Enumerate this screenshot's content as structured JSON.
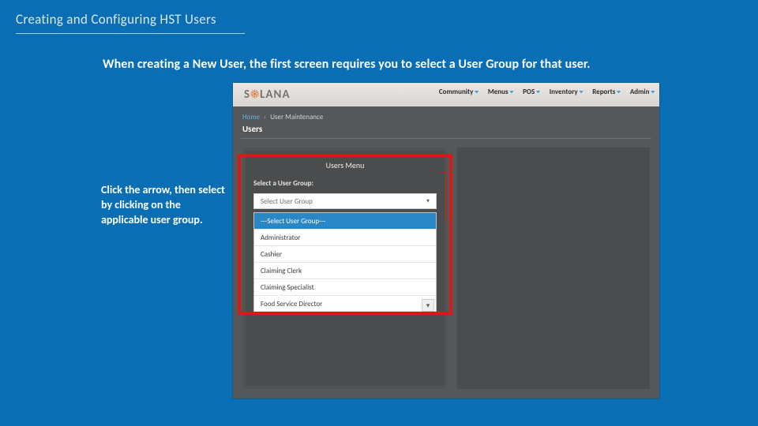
{
  "slide": {
    "title": "Creating  and Configuring HST Users",
    "intro": "When creating a New User, the first screen requires you to select a User Group for that user.",
    "tip": "Click the arrow, then select by clicking on the applicable user group."
  },
  "app": {
    "logo_left": "S",
    "logo_sun": "☀",
    "logo_right": "LANA",
    "nav": [
      "Community",
      "Menus",
      "POS",
      "Inventory",
      "Reports",
      "Admin"
    ],
    "breadcrumb_home": "Home",
    "breadcrumb_sep": "›",
    "breadcrumb_current": "User Maintenance",
    "page_title": "Users",
    "panel_title": "Users Menu",
    "panel_sub": "Select a User Group:",
    "select_value": "Select User Group",
    "dropdown": [
      "---Select User Group---",
      "Administrator",
      "Cashier",
      "Claiming Clerk",
      "Claiming Specialist",
      "Food Service Director"
    ],
    "caret_glyph": "▾",
    "scroll_glyph": "▾"
  }
}
